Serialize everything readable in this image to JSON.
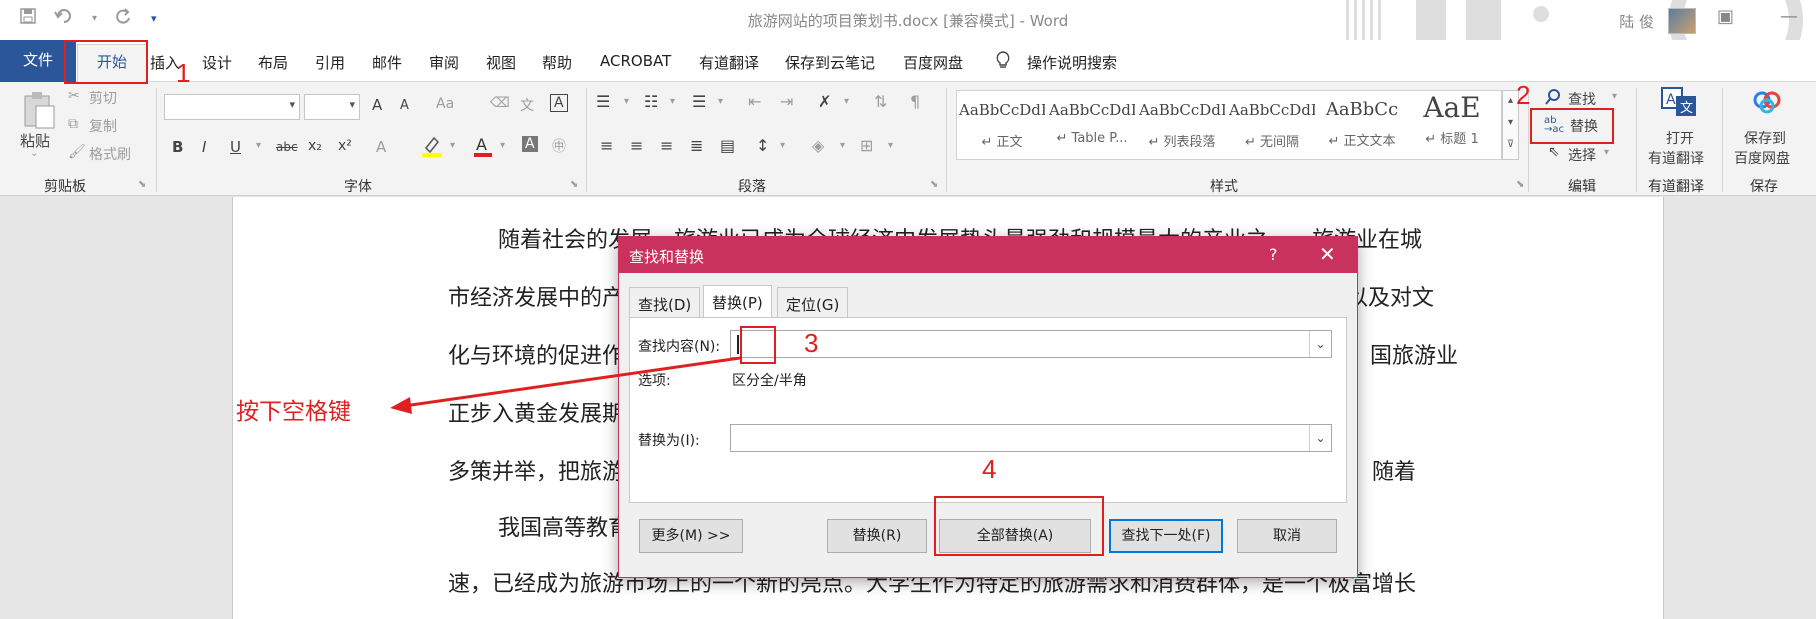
{
  "app": {
    "doc_title": "旅游网站的项目策划书.docx [兼容模式]  -  Word",
    "user_name": "陆 俊",
    "quick_access": {
      "save_icon": "save-icon",
      "undo_icon": "undo-icon",
      "redo_icon": "redo-icon",
      "customize_icon": "customize-icon"
    }
  },
  "tabs": [
    "文件",
    "开始",
    "插入",
    "设计",
    "布局",
    "引用",
    "邮件",
    "审阅",
    "视图",
    "帮助",
    "ACROBAT",
    "有道翻译",
    "保存到云笔记",
    "百度网盘",
    "操作说明搜索"
  ],
  "ribbon": {
    "clipboard": {
      "paste": "粘贴",
      "cut": "剪切",
      "copy": "复制",
      "format_painter": "格式刷",
      "label": "剪贴板"
    },
    "font": {
      "label": "字体",
      "bold": "B",
      "italic": "I",
      "underline": "U",
      "strike": "abc",
      "sub": "x₂",
      "sup": "x²",
      "grow": "A",
      "shrink": "A",
      "case": "Aa",
      "font_color": "A"
    },
    "paragraph": {
      "label": "段落"
    },
    "styles": {
      "label": "样式",
      "items": [
        {
          "sample": "AaBbCcDdI",
          "name": "↵ 正文"
        },
        {
          "sample": "AaBbCcDdI",
          "name": "↵ Table P..."
        },
        {
          "sample": "AaBbCcDdI",
          "name": "↵ 列表段落"
        },
        {
          "sample": "AaBbCcDdI",
          "name": "↵ 无间隔"
        },
        {
          "sample": "AaBbCc",
          "name": "↵ 正文文本"
        },
        {
          "sample": "AaE",
          "name": "↵ 标题 1"
        }
      ]
    },
    "editing": {
      "find": "查找",
      "replace": "替换",
      "select": "选择",
      "label": "编辑"
    },
    "youdao": {
      "line1": "打开",
      "line2": "有道翻译",
      "label": "有道翻译"
    },
    "baidu": {
      "line1": "保存到",
      "line2": "百度网盘",
      "label": "保存"
    }
  },
  "document": {
    "lines": [
      "随着社会的发展，旅游业已成为全球经济中发展势头最强劲和规模最大的产业之一，旅游业在城",
      "市经济发展中的产",
      "以及对文",
      "化与环境的促进作",
      "国旅游业",
      "正步入黄金发展期",
      "多策并举，把旅游",
      "随着",
      "我国高等教育",
      "速，已经成为旅游市场上的一个新的亮点。大学生作为特定的旅游需求和消费群体，是一个极富增长"
    ]
  },
  "dialog": {
    "title": "查找和替换",
    "help": "?",
    "close": "✕",
    "tabs": [
      "查找(D)",
      "替换(P)",
      "定位(G)"
    ],
    "find_label": "查找内容(N):",
    "find_value": "",
    "options_label": "选项:",
    "options_value": "区分全/半角",
    "replace_label": "替换为(I):",
    "replace_value": "",
    "buttons": {
      "more": "更多(M) >>",
      "replace": "替换(R)",
      "replace_all": "全部替换(A)",
      "find_next": "查找下一处(F)",
      "cancel": "取消"
    }
  },
  "annotations": {
    "n1": "1",
    "n2": "2",
    "n3": "3",
    "n4": "4",
    "hint": "按下空格键",
    "color": "#e02020"
  }
}
